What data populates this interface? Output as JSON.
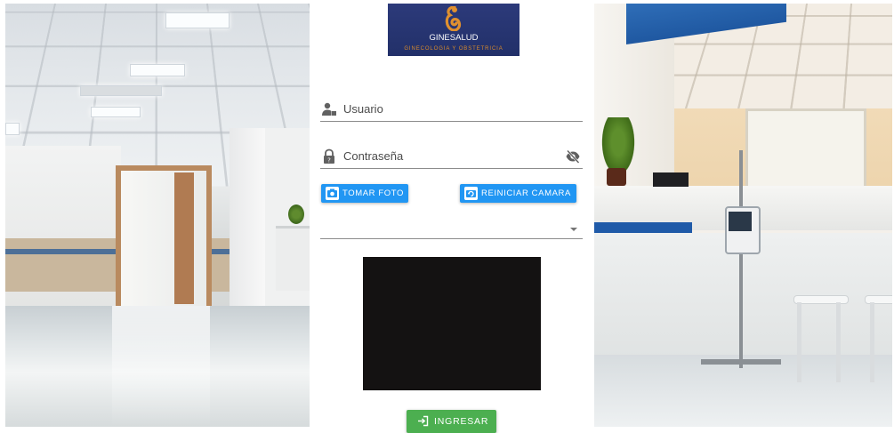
{
  "brand": {
    "name": "GINESALUD",
    "tagline": "GINECOLOGIA Y OBSTETRICIA"
  },
  "form": {
    "username_label": "Usuario",
    "password_label": "Contraseña",
    "take_photo_label": "TOMAR FOTO",
    "restart_camera_label": "REINICIAR CAMARA",
    "select_value": "",
    "submit_label": "INGRESAR"
  },
  "icons": {
    "username": "user-key-icon",
    "password": "lock-question-icon",
    "toggle_password": "eye-off-icon",
    "take_photo": "camera-icon",
    "restart_camera": "camera-switch-icon",
    "dropdown": "caret-down-icon",
    "submit": "login-icon"
  },
  "colors": {
    "primary_button": "#2196f3",
    "submit_button": "#4caf50",
    "logo_background": "#2c3a7a",
    "logo_accent": "#d98b2c",
    "camera_preview": "#141212"
  }
}
